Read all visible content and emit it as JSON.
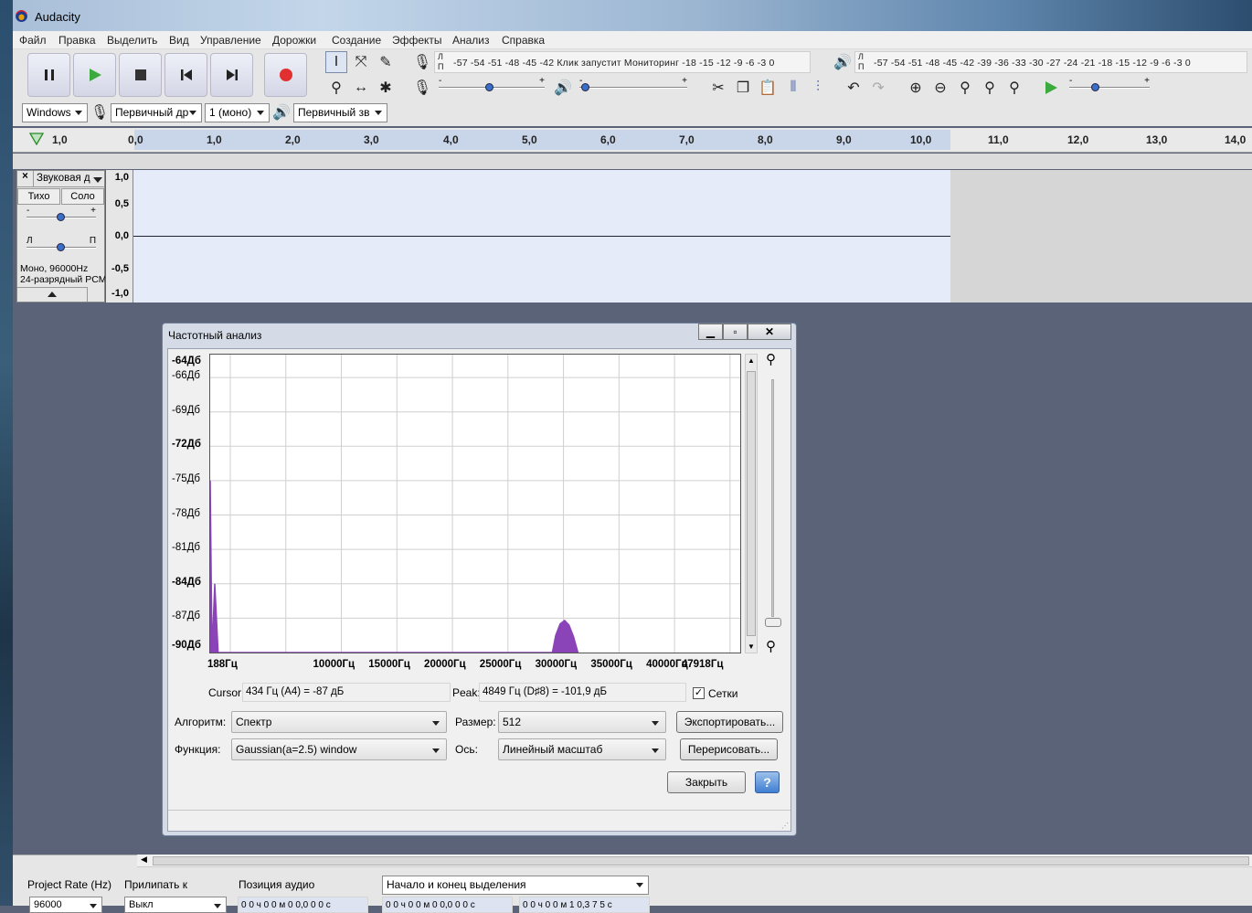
{
  "app": {
    "title": "Audacity"
  },
  "menu": [
    "Файл",
    "Правка",
    "Выделить",
    "Вид",
    "Управление",
    "Дорожки",
    "Создание",
    "Эффекты",
    "Анализ",
    "Справка"
  ],
  "meters": {
    "record_lr": [
      "Л",
      "П"
    ],
    "record_scale": "-57 -54 -51 -48 -45 -42 Клик запустит Мониторинг -18 -15 -12 -9 -6 -3 0",
    "play_lr": [
      "Л",
      "П"
    ],
    "play_scale": "-57 -54 -51 -48 -45 -42 -39 -36 -33 -30 -27 -24 -21 -18 -15 -12 -9 -6 -3 0"
  },
  "sliders": {
    "rec_minus": "-",
    "rec_plus": "+",
    "play_minus": "-",
    "play_plus": "+",
    "speed_minus": "-",
    "speed_plus": "+"
  },
  "devices": {
    "host": "Windows",
    "rec_device": "Первичный др",
    "channels": "1 (моно)",
    "play_device": "Первичный зв"
  },
  "ruler": [
    "1,0",
    "0,0",
    "1,0",
    "2,0",
    "3,0",
    "4,0",
    "5,0",
    "6,0",
    "7,0",
    "8,0",
    "9,0",
    "10,0",
    "11,0",
    "12,0",
    "13,0",
    "14,0"
  ],
  "track": {
    "close": "×",
    "name": "Звуковая д",
    "mute": "Тихо",
    "solo": "Соло",
    "gain_minus": "-",
    "gain_plus": "+",
    "pan_left": "Л",
    "pan_right": "П",
    "info1": "Моно, 96000Hz",
    "info2": "24-разрядный PCM",
    "scale": [
      "1,0",
      "0,5",
      "0,0",
      "-0,5",
      "-1,0"
    ]
  },
  "dialog": {
    "title": "Частотный анализ",
    "y_labels": [
      "-64Дб",
      "-66Дб",
      "-69Дб",
      "-72Дб",
      "-75Дб",
      "-78Дб",
      "-81Дб",
      "-84Дб",
      "-87Дб",
      "-90Дб"
    ],
    "x_labels": [
      "188Гц",
      "10000Гц",
      "15000Гц",
      "20000Гц",
      "25000Гц",
      "30000Гц",
      "35000Гц",
      "40000Гц",
      "47918Гц"
    ],
    "cursor_label": "Cursor:",
    "cursor_value": "434 Гц (A4) = -87 дБ",
    "peak_label": "Peak:",
    "peak_value": "4849 Гц (D♯8) = -101,9 дБ",
    "grids_label": "Сетки",
    "algorithm_label": "Алгоритм:",
    "algorithm_value": "Спектр",
    "size_label": "Размер:",
    "size_value": "512",
    "export_button": "Экспортировать...",
    "function_label": "Функция:",
    "function_value": "Gaussian(a=2.5) window",
    "axis_label": "Ось:",
    "axis_value": "Линейный масштаб",
    "replot_button": "Перерисовать...",
    "close_button": "Закрыть",
    "help_button": "?",
    "grids_checked": true
  },
  "chart_data": {
    "type": "area",
    "title": "",
    "xlabel": "",
    "ylabel": "",
    "x_tick_labels": [
      "188Гц",
      "10000Гц",
      "15000Гц",
      "20000Гц",
      "25000Гц",
      "30000Гц",
      "35000Гц",
      "40000Гц",
      "47918Гц"
    ],
    "y_tick_labels": [
      "-64Дб",
      "-66Дб",
      "-69Дб",
      "-72Дб",
      "-75Дб",
      "-78Дб",
      "-81Дб",
      "-84Дб",
      "-87Дб",
      "-90Дб"
    ],
    "xlim": [
      188,
      47918
    ],
    "ylim": [
      -90,
      -64
    ],
    "grid": true,
    "color": "#8a44b8",
    "series": [
      {
        "values": [
          [
            188,
            -75
          ],
          [
            350,
            -90
          ],
          [
            600,
            -84
          ],
          [
            900,
            -90
          ],
          [
            31000,
            -90
          ],
          [
            31300,
            -88.5
          ],
          [
            31700,
            -87.5
          ],
          [
            32100,
            -87.2
          ],
          [
            32500,
            -87.6
          ],
          [
            32900,
            -88.6
          ],
          [
            33300,
            -90
          ]
        ]
      }
    ]
  },
  "status": {
    "rate_label": "Project Rate (Hz)",
    "rate_value": "96000",
    "snap_label": "Прилипать к",
    "snap_value": "Выкл",
    "pos_label": "Позиция аудио",
    "sel_label": "Начало и конец выделения",
    "pos_value": "0 0 ч 0 0 м 0 0,0 0 0 с",
    "sel_start": "0 0 ч 0 0 м 0 0,0 0 0 с",
    "sel_end": "0 0 ч 0 0 м 1 0,3 7 5 с"
  }
}
